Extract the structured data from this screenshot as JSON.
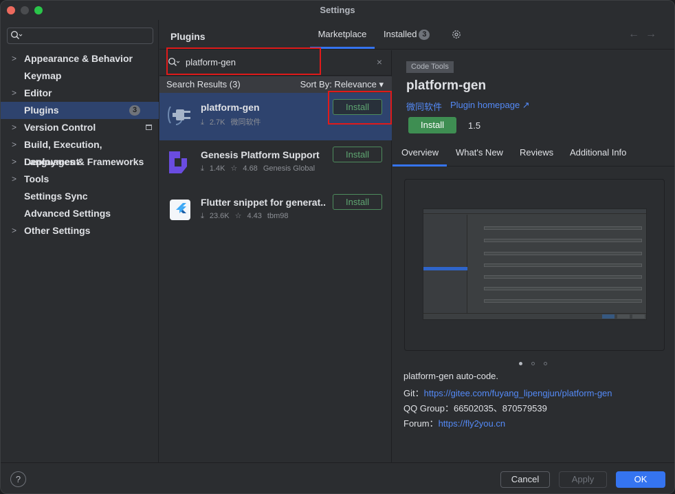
{
  "window": {
    "title": "Settings"
  },
  "sidebar": {
    "search_icon": "search-icon",
    "items": [
      {
        "label": "Appearance & Behavior",
        "expandable": true
      },
      {
        "label": "Keymap",
        "expandable": false
      },
      {
        "label": "Editor",
        "expandable": true
      },
      {
        "label": "Plugins",
        "expandable": false,
        "selected": true,
        "badge": "3"
      },
      {
        "label": "Version Control",
        "expandable": true
      },
      {
        "label": "Build, Execution, Deployment",
        "expandable": true
      },
      {
        "label": "Languages & Frameworks",
        "expandable": true
      },
      {
        "label": "Tools",
        "expandable": true
      },
      {
        "label": "Settings Sync",
        "expandable": false
      },
      {
        "label": "Advanced Settings",
        "expandable": false
      },
      {
        "label": "Other Settings",
        "expandable": true
      }
    ]
  },
  "header": {
    "title": "Plugins",
    "tabs": {
      "marketplace": "Marketplace",
      "installed": "Installed",
      "installed_badge": "3"
    },
    "back_arrow": "←",
    "forward_arrow": "→"
  },
  "search": {
    "value": "platform-gen",
    "clear": "×"
  },
  "results": {
    "label": "Search Results (3)",
    "sort": "Sort By: Relevance ▾",
    "plugins": [
      {
        "name": "platform-gen",
        "downloads": "2.7K",
        "rating": "",
        "vendor": "微同软件",
        "button": "Install"
      },
      {
        "name": "Genesis Platform Support",
        "downloads": "1.4K",
        "rating": "4.68",
        "vendor": "Genesis Global",
        "button": "Install"
      },
      {
        "name": "Flutter snippet for generat...",
        "downloads": "23.6K",
        "rating": "4.43",
        "vendor": "tbm98",
        "button": "Install"
      }
    ]
  },
  "detail": {
    "tag": "Code Tools",
    "title": "platform-gen",
    "vendor": "微同软件",
    "homepage": "Plugin homepage ↗",
    "install": "Install",
    "version": "1.5",
    "tabs": [
      "Overview",
      "What's New",
      "Reviews",
      "Additional Info"
    ],
    "description": {
      "line1": "platform-gen auto-code.",
      "git_label": "Git：",
      "git_url": "https://gitee.com/fuyang_lipengjun/platform-gen",
      "qq": "QQ Group：66502035、870579539",
      "forum_label": "Forum：",
      "forum_url": "https://fly2you.cn"
    }
  },
  "footer": {
    "help": "?",
    "cancel": "Cancel",
    "apply": "Apply",
    "ok": "OK"
  },
  "colors": {
    "accent": "#3574f0",
    "selection": "#2e436e",
    "install_green": "#3e8e52",
    "link": "#548af7",
    "highlight_box": "#e11a1a"
  }
}
